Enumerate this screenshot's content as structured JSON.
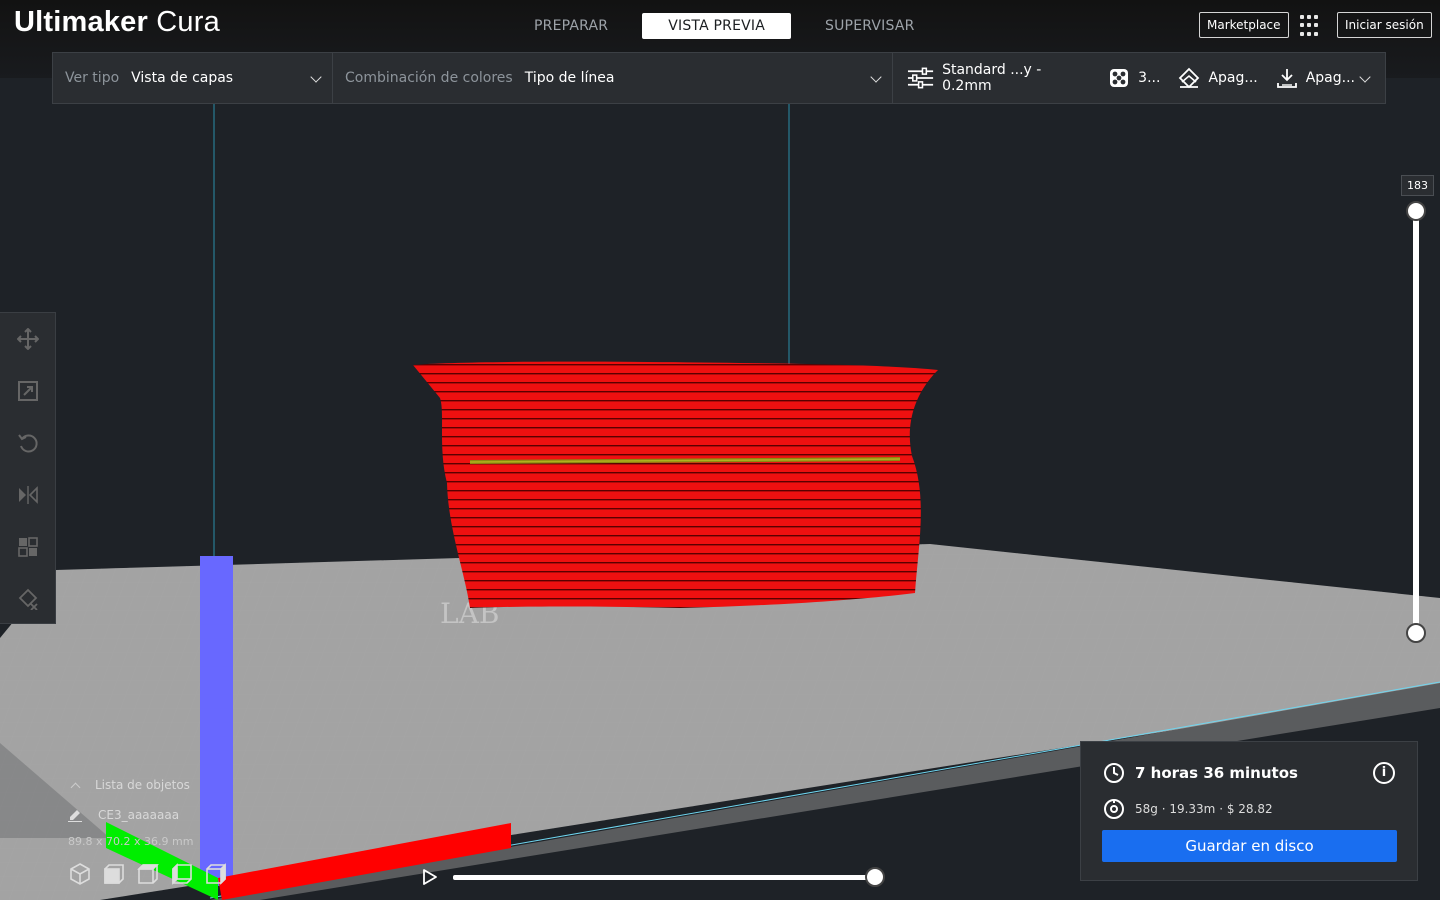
{
  "header": {
    "brand_bold": "Ultimaker",
    "brand_light": "Cura",
    "stages": [
      {
        "label": "PREPARAR",
        "active": false
      },
      {
        "label": "VISTA PREVIA",
        "active": true
      },
      {
        "label": "SUPERVISAR",
        "active": false
      }
    ],
    "marketplace_label": "Marketplace",
    "signin_label": "Iniciar sesión"
  },
  "toolbar": {
    "view_type_label": "Ver tipo",
    "view_type_value": "Vista de capas",
    "color_scheme_label": "Combinación de colores",
    "color_scheme_value": "Tipo de línea",
    "profile": "Standard ...y - 0.2mm",
    "infill": "3...",
    "support": "Apag...",
    "adhesion": "Apag..."
  },
  "layer_slider": {
    "current_layer": "183",
    "max_fraction": 1.0,
    "min_fraction": 0.0
  },
  "object_list": {
    "title": "Lista de objetos",
    "object_name": "CE3_aaaaaaa",
    "dimensions": "89.8 x 70.2 x 36.9 mm"
  },
  "simulation": {
    "progress": 1.0
  },
  "print_info": {
    "time": "7 horas 36 minutos",
    "material": "58g · 19.33m · $ 28.82",
    "save_label": "Guardar en disco"
  },
  "colors": {
    "accent": "#196ef0",
    "model": "#ee1111",
    "axis_x": "#ff0000",
    "axis_y": "#00ff00",
    "axis_z": "#6666ff"
  }
}
